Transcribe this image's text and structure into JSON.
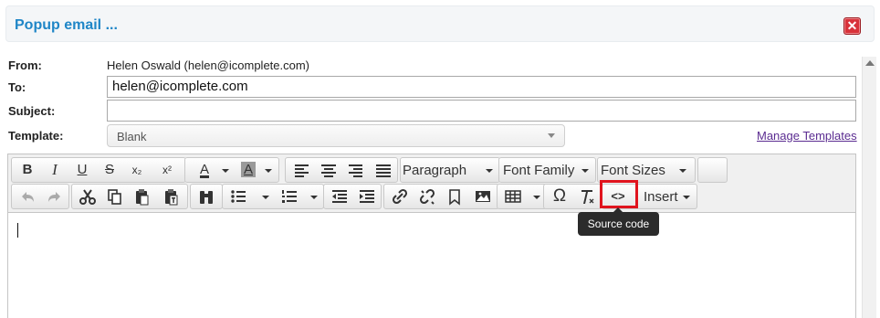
{
  "popup": {
    "title": "Popup email ...",
    "close_icon": "close-icon"
  },
  "form": {
    "from_label": "From:",
    "from_value": "Helen Oswald (helen@icomplete.com)",
    "to_label": "To:",
    "to_value": "helen@icomplete.com",
    "subject_label": "Subject:",
    "subject_value": "",
    "template_label": "Template:",
    "template_value": "Blank",
    "manage_templates": "Manage Templates"
  },
  "toolbar": {
    "row1": {
      "bold": "B",
      "italic": "I",
      "underline": "U",
      "strike": "S",
      "subscript": "x₂",
      "superscript": "x²",
      "font_color": "A",
      "bg_color": "A",
      "paragraph": "Paragraph",
      "font_family": "Font Family",
      "font_sizes": "Font Sizes"
    },
    "row2": {
      "omega": "Ω",
      "source_code": "<>",
      "insert": "Insert"
    }
  },
  "tooltip": {
    "text": "Source code"
  },
  "colors": {
    "title": "#1f86c7",
    "close": "#d8323a",
    "highlight": "#e0141e",
    "link": "#5b2c91"
  }
}
